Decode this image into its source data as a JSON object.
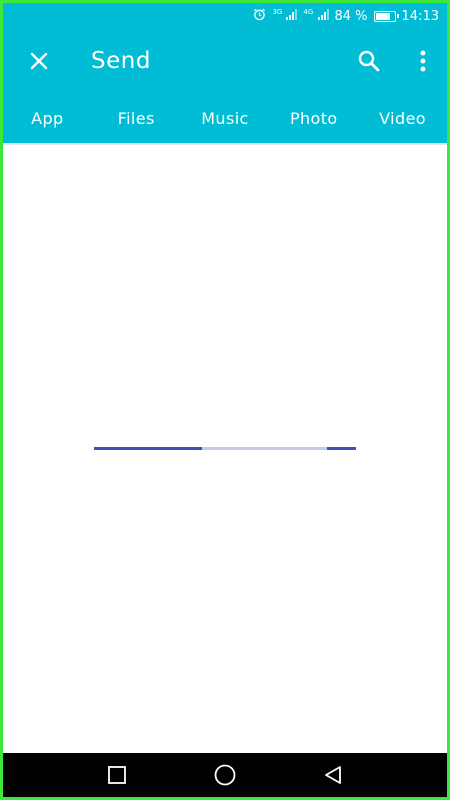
{
  "status_bar": {
    "alarm_icon": "alarm-clock-icon",
    "network_1": "3G",
    "network_2": "4G",
    "battery_percent": "84 %",
    "battery_level": 0.84,
    "time": "14:13"
  },
  "toolbar": {
    "title": "Send",
    "close_icon": "close-icon",
    "search_icon": "search-icon",
    "more_icon": "more-vert-icon"
  },
  "tabs": [
    {
      "label": "App"
    },
    {
      "label": "Files"
    },
    {
      "label": "Music"
    },
    {
      "label": "Photo"
    },
    {
      "label": "Video"
    }
  ],
  "colors": {
    "app_bar": "#00bcd4",
    "progress_indicator": "#3f51b5",
    "progress_track": "#c5cae9",
    "frame": "#3ee83a",
    "nav_bar": "#000000"
  },
  "loading_indicator": {
    "type": "indeterminate-linear-progress"
  },
  "nav_bar": {
    "recents_icon": "square-recents-icon",
    "home_icon": "circle-home-icon",
    "back_icon": "triangle-back-icon"
  }
}
